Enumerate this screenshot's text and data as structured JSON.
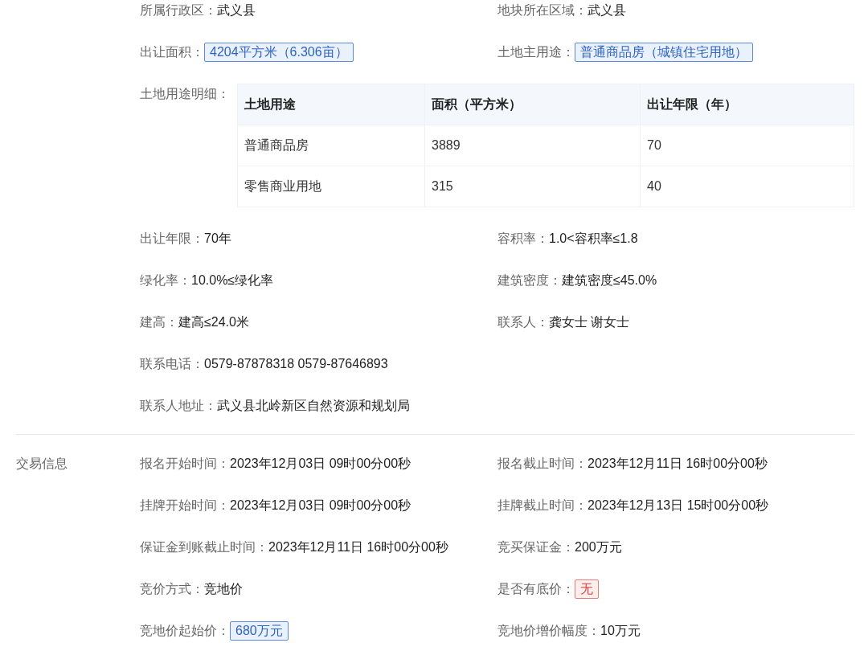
{
  "sections": [
    {
      "blocks": [
        {
          "kind": "fields",
          "rows": [
            [
              {
                "label": "所属行政区：",
                "value": "武义县",
                "kind": "text"
              },
              {
                "label": "地块所在区域：",
                "value": "武义县",
                "kind": "text"
              }
            ],
            [
              {
                "label": "出让面积：",
                "value": "4204平方米（6.306亩）",
                "kind": "tag"
              },
              {
                "label": "土地主用途：",
                "value": "普通商品房（城镇住宅用地）",
                "kind": "tag"
              }
            ]
          ]
        },
        {
          "kind": "table",
          "label": "土地用途明细：",
          "columns": [
            "土地用途",
            "面积（平方米）",
            "出让年限（年）"
          ],
          "rows": [
            [
              "普通商品房",
              "3889",
              "70"
            ],
            [
              "零售商业用地",
              "315",
              "40"
            ]
          ]
        },
        {
          "kind": "fields",
          "rows": [
            [
              {
                "label": "出让年限：",
                "value": "70年",
                "kind": "text"
              },
              {
                "label": "容积率：",
                "value": "1.0<容积率≤1.8",
                "kind": "text"
              }
            ],
            [
              {
                "label": "绿化率：",
                "value": "10.0%≤绿化率",
                "kind": "text"
              },
              {
                "label": "建筑密度：",
                "value": "建筑密度≤45.0%",
                "kind": "text"
              }
            ],
            [
              {
                "label": "建高：",
                "value": "建高≤24.0米",
                "kind": "text"
              },
              {
                "label": "联系人：",
                "value": "龚女士 谢女士",
                "kind": "text"
              }
            ],
            [
              {
                "label": "联系电话：",
                "value": "0579-87878318 0579-87646893",
                "kind": "text"
              }
            ],
            [
              {
                "label": "联系人地址：",
                "value": "武义县北岭新区自然资源和规划局",
                "kind": "text"
              }
            ]
          ]
        }
      ]
    },
    {
      "title": "交易信息",
      "blocks": [
        {
          "kind": "fields",
          "rows": [
            [
              {
                "label": "报名开始时间：",
                "value": "2023年12月03日 09时00分00秒",
                "kind": "text"
              },
              {
                "label": "报名截止时间：",
                "value": "2023年12月11日 16时00分00秒",
                "kind": "text"
              }
            ],
            [
              {
                "label": "挂牌开始时间：",
                "value": "2023年12月03日 09时00分00秒",
                "kind": "text"
              },
              {
                "label": "挂牌截止时间：",
                "value": "2023年12月13日 15时00分00秒",
                "kind": "text"
              }
            ],
            [
              {
                "label": "保证金到账截止时间：",
                "value": "2023年12月11日 16时00分00秒",
                "kind": "text"
              },
              {
                "label": "竞买保证金：",
                "value": "200万元",
                "kind": "text"
              }
            ],
            [
              {
                "label": "竞价方式：",
                "value": "竞地价",
                "kind": "text"
              },
              {
                "label": "是否有底价：",
                "value": "无",
                "kind": "alert"
              }
            ],
            [
              {
                "label": "竞地价起始价：",
                "value": "680万元",
                "kind": "tag"
              },
              {
                "label": "竞地价增价幅度：",
                "value": "10万元",
                "kind": "text"
              }
            ]
          ]
        }
      ]
    }
  ]
}
